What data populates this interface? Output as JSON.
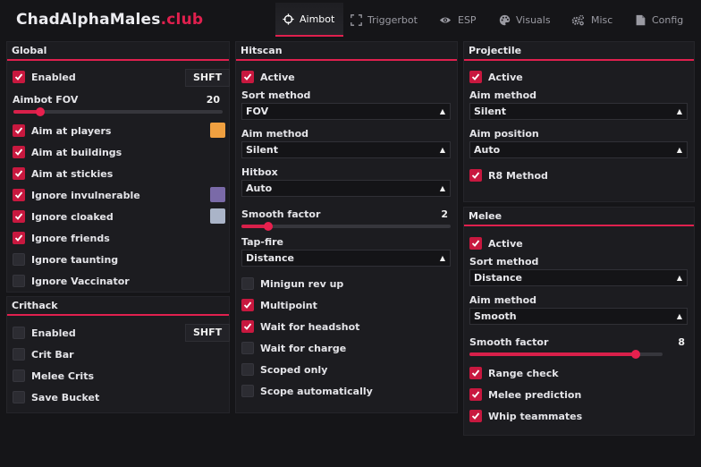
{
  "app": {
    "logo_main": "ChadAlphaMales",
    "logo_accent": ".club"
  },
  "tabs": [
    {
      "label": "Aimbot",
      "icon": "crosshair-icon",
      "active": true
    },
    {
      "label": "Triggerbot",
      "icon": "bracket-icon",
      "active": false
    },
    {
      "label": "ESP",
      "icon": "eye-icon",
      "active": false
    },
    {
      "label": "Visuals",
      "icon": "palette-icon",
      "active": false
    },
    {
      "label": "Misc",
      "icon": "gears-icon",
      "active": false
    },
    {
      "label": "Config",
      "icon": "file-icon",
      "active": false
    }
  ],
  "global": {
    "title": "Global",
    "enabled_label": "Enabled",
    "enabled_key": "SHFT",
    "fov_label": "Aimbot FOV",
    "fov_value": "20",
    "fov_fraction": 0.13,
    "items": [
      {
        "label": "Aim at players",
        "checked": true,
        "color": "#f0a040"
      },
      {
        "label": "Aim at buildings",
        "checked": true
      },
      {
        "label": "Aim at stickies",
        "checked": true
      },
      {
        "label": "Ignore invulnerable",
        "checked": true,
        "color": "#7a6aa8"
      },
      {
        "label": "Ignore cloaked",
        "checked": true,
        "color": "#aab4c8"
      },
      {
        "label": "Ignore friends",
        "checked": true
      },
      {
        "label": "Ignore taunting",
        "checked": false
      },
      {
        "label": "Ignore Vaccinator",
        "checked": false
      }
    ]
  },
  "crithack": {
    "title": "Crithack",
    "enabled_label": "Enabled",
    "enabled_key": "SHFT",
    "items": [
      {
        "label": "Crit Bar",
        "checked": false
      },
      {
        "label": "Melee Crits",
        "checked": false
      },
      {
        "label": "Save Bucket",
        "checked": false
      }
    ]
  },
  "hitscan": {
    "title": "Hitscan",
    "active_label": "Active",
    "sort_label": "Sort method",
    "sort_value": "FOV",
    "aim_label": "Aim method",
    "aim_value": "Silent",
    "hitbox_label": "Hitbox",
    "hitbox_value": "Auto",
    "smooth_label": "Smooth factor",
    "smooth_value": "2",
    "smooth_fraction": 0.13,
    "tapfire_label": "Tap-fire",
    "tapfire_value": "Distance",
    "items": [
      {
        "label": "Minigun rev up",
        "checked": false
      },
      {
        "label": "Multipoint",
        "checked": true
      },
      {
        "label": "Wait for headshot",
        "checked": true
      },
      {
        "label": "Wait for charge",
        "checked": false
      },
      {
        "label": "Scoped only",
        "checked": false
      },
      {
        "label": "Scope automatically",
        "checked": false
      }
    ]
  },
  "projectile": {
    "title": "Projectile",
    "active_label": "Active",
    "aim_label": "Aim method",
    "aim_value": "Silent",
    "pos_label": "Aim position",
    "pos_value": "Auto",
    "r8_label": "R8 Method"
  },
  "melee": {
    "title": "Melee",
    "active_label": "Active",
    "sort_label": "Sort method",
    "sort_value": "Distance",
    "aim_label": "Aim method",
    "aim_value": "Smooth",
    "smooth_label": "Smooth factor",
    "smooth_value": "8",
    "smooth_fraction": 0.86,
    "items": [
      {
        "label": "Range check",
        "checked": true
      },
      {
        "label": "Melee prediction",
        "checked": true
      },
      {
        "label": "Whip teammates",
        "checked": true
      }
    ]
  }
}
